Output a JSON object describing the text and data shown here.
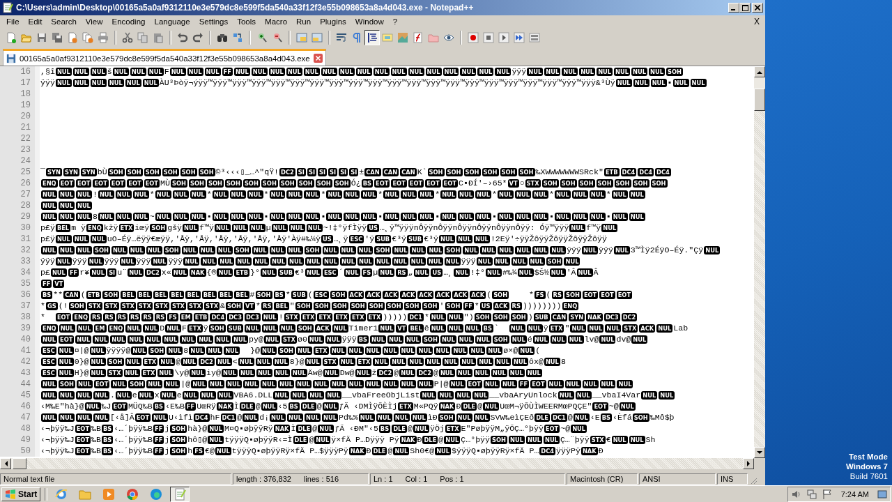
{
  "window": {
    "title": "C:\\Users\\admin\\Desktop\\00165a5a0af9312110e3e579dc8e599f5da540a33f12f3e55b098653a8a4d043.exe - Notepad++"
  },
  "menu": [
    "File",
    "Edit",
    "Search",
    "View",
    "Encoding",
    "Language",
    "Settings",
    "Tools",
    "Macro",
    "Run",
    "Plugins",
    "Window",
    "?"
  ],
  "menu_close": "X",
  "toolbar": [
    {
      "kind": "new",
      "pressed": false
    },
    {
      "kind": "open",
      "pressed": false
    },
    {
      "kind": "save",
      "pressed": false
    },
    {
      "kind": "saveall",
      "pressed": false
    },
    {
      "kind": "close",
      "pressed": false
    },
    {
      "kind": "closeall",
      "pressed": false
    },
    {
      "kind": "print",
      "pressed": false
    },
    {
      "kind": "sep"
    },
    {
      "kind": "cut",
      "pressed": false
    },
    {
      "kind": "copy",
      "pressed": false
    },
    {
      "kind": "paste",
      "pressed": false
    },
    {
      "kind": "sep"
    },
    {
      "kind": "undo",
      "pressed": false
    },
    {
      "kind": "redo",
      "pressed": false
    },
    {
      "kind": "sep"
    },
    {
      "kind": "find",
      "pressed": false
    },
    {
      "kind": "replace",
      "pressed": false
    },
    {
      "kind": "sep"
    },
    {
      "kind": "zoomin",
      "pressed": false
    },
    {
      "kind": "zoomout",
      "pressed": false
    },
    {
      "kind": "sep"
    },
    {
      "kind": "syncv",
      "pressed": false
    },
    {
      "kind": "synch",
      "pressed": false
    },
    {
      "kind": "sep"
    },
    {
      "kind": "wrap",
      "pressed": false
    },
    {
      "kind": "pilcrow",
      "pressed": false
    },
    {
      "kind": "indent",
      "pressed": true
    },
    {
      "kind": "lang",
      "pressed": false
    },
    {
      "kind": "map",
      "pressed": false
    },
    {
      "kind": "func",
      "pressed": false
    },
    {
      "kind": "folder",
      "pressed": false
    },
    {
      "kind": "eye",
      "pressed": false
    },
    {
      "kind": "sep"
    },
    {
      "kind": "record",
      "pressed": false
    },
    {
      "kind": "stop",
      "pressed": false
    },
    {
      "kind": "play",
      "pressed": false
    },
    {
      "kind": "playmulti",
      "pressed": false
    },
    {
      "kind": "savemacro",
      "pressed": false
    }
  ],
  "tabs": [
    {
      "label": "00165a5a0af9312110e3e579dc8e599f5da540a33f12f3e55b098653a8a4d043.exe",
      "selected": true
    }
  ],
  "editor": {
    "lines": [
      {
        "number": "16",
        "parts": [
          ",§î",
          [
            "NUL",
            "NUL",
            "NUL"
          ],
          "š",
          [
            "NUL",
            "NUL",
            "NUL"
          ],
          "F",
          [
            "NUL",
            "NUL",
            "NUL",
            "FF",
            "NUL",
            "NUL",
            "NUL",
            "NUL",
            "NUL",
            "NUL",
            "NUL",
            "NUL",
            "NUL",
            "NUL",
            "NUL",
            "NUL",
            "NUL",
            "NUL",
            "NUL",
            "NUL"
          ],
          "ÿÿÿ",
          [
            "NUL",
            "NUL",
            "NUL",
            "NUL",
            "NUL",
            "NUL",
            "NUL",
            "NUL",
            "SOH"
          ]
        ]
      },
      {
        "number": "17",
        "parts": [
          "ÿÿÿ",
          [
            "NUL",
            "NUL",
            "NUL",
            "NUL",
            "NUL",
            "NUL"
          ],
          "ÀU³Þòÿ¬ýÿÿ™ÿÿÿ™ÿÿÿ™ÿÿÿ™ÿÿÿ™ÿÿÿ™ÿÿÿ™ÿÿÿ™ÿÿÿ™ÿÿÿ™ÿÿÿ™ÿÿÿ™ÿÿÿ™ÿÿÿ™ÿÿÿ™ÿÿÿ™ÿÿÿ™ÿÿÿ™ÿÿÿ™ÿÿÿ™ÿÿÿ&³Ùÿ",
          [
            "NUL",
            "NUL",
            "NUL"
          ],
          "▪",
          [
            "NUL",
            "NUL"
          ]
        ]
      },
      {
        "number": "18"
      },
      {
        "number": "19"
      },
      {
        "number": "20"
      },
      {
        "number": "21"
      },
      {
        "number": "22"
      },
      {
        "number": "23"
      },
      {
        "number": "24"
      },
      {
        "number": "25",
        "parts": [
          "¯",
          [
            "SYN",
            "SYN",
            "SYN"
          ],
          "bÙ",
          [
            "SOH",
            "SOH",
            "SOH",
            "SOH",
            "SOH",
            "SOH"
          ],
          "©³‹‹‹▯_…^″qŸ!",
          [
            "DC2",
            "SI",
            "SI",
            "SI",
            "SI",
            "SI",
            "SI"
          ],
          "±",
          [
            "CAN",
            "CAN",
            "CAN"
          ],
          "K`",
          [
            "SOH",
            "SOH",
            "SOH",
            "SOH",
            "SOH",
            "SOH"
          ],
          "‰XWWWWWWWSRck\"",
          [
            "ETB",
            "DC4",
            "DC4",
            "DC4"
          ]
        ]
      },
      {
        "number": "26",
        "parts": [
          [
            "ENQ",
            "EOT",
            "EOT",
            "EOT",
            "EOT",
            "EOT",
            "EOT"
          ],
          "MÙ",
          [
            "SOH",
            "SOH",
            "SOH",
            "SOH",
            "SOH",
            "SOH",
            "SOH",
            "SOH",
            "SOH",
            "SOH"
          ],
          "Ó¿",
          [
            "BS",
            "EOT",
            "EOT",
            "EOT",
            "EOT",
            "EOT"
          ],
          "C▪ÐÍ'–›65*",
          [
            "VT"
          ],
          "○",
          [
            "STX",
            "SOH",
            "SOH",
            "SOH",
            "SOH",
            "SOH",
            "SOH",
            "SOH"
          ]
        ]
      },
      {
        "number": "27",
        "parts": [
          [
            "NUL",
            "NUL",
            "NUL"
          ],
          "!",
          [
            "NUL",
            "NUL",
            "NUL"
          ],
          "*",
          [
            "NUL",
            "NUL",
            "NUL"
          ],
          "*",
          [
            "NUL",
            "NUL",
            "NUL"
          ],
          "*",
          [
            "NUL",
            "NUL",
            "NUL"
          ],
          "*",
          [
            "NUL",
            "NUL",
            "NUL"
          ],
          "*",
          [
            "NUL",
            "NUL",
            "NUL"
          ],
          "*",
          [
            "NUL",
            "NUL",
            "NUL"
          ],
          "*",
          [
            "NUL",
            "NUL",
            "NUL"
          ],
          "*",
          [
            "NUL",
            "NUL",
            "NUL"
          ],
          "*",
          [
            "NUL",
            "NUL"
          ]
        ]
      },
      {
        "number": "28",
        "parts": [
          [
            "NUL",
            "NUL",
            "NUL"
          ]
        ]
      },
      {
        "number": "29",
        "parts": [
          [
            "NUL",
            "NUL",
            "NUL"
          ],
          "8",
          [
            "NUL",
            "NUL",
            "NUL"
          ],
          "~",
          [
            "NUL",
            "NUL",
            "NUL"
          ],
          "▪",
          [
            "NUL",
            "NUL",
            "NUL"
          ],
          "▪",
          [
            "NUL",
            "NUL",
            "NUL"
          ],
          "▪",
          [
            "NUL",
            "NUL",
            "NUL"
          ],
          "▪",
          [
            "NUL",
            "NUL",
            "NUL"
          ],
          "▪",
          [
            "NUL",
            "NUL",
            "NUL"
          ],
          "▪",
          [
            "NUL",
            "NUL",
            "NUL"
          ],
          "▪",
          [
            "NUL",
            "NUL",
            "NUL"
          ],
          "▪",
          [
            "NUL",
            "NUL"
          ]
        ]
      },
      {
        "number": "30",
        "parts": [
          "p£ÿ",
          [
            "BEL"
          ],
          "m ÿ",
          [
            "ENQ"
          ],
          "kžÿ",
          [
            "ETX"
          ],
          "iœÿ",
          [
            "SOH"
          ],
          "gšÿ",
          [
            "NUL"
          ],
          "f™ÿ",
          [
            "NUL",
            "NUL",
            "NUL"
          ],
          "µ",
          [
            "NUL",
            "NUL",
            "NUL"
          ],
          "~!‡°ÿfÌÿÿ",
          [
            "US"
          ],
          "…¸ÿ™ÿÿÿnÔÿÿnÔÿÿnÔÿÿnÔÿÿnÔÿÿnÔÿÿ: Óÿ™ÿÿÿ",
          [
            "NUL"
          ],
          "f™ÿ",
          [
            "NUL"
          ]
        ]
      },
      {
        "number": "31",
        "parts": [
          "p£ÿ",
          [
            "NUL",
            "NUL",
            "NUL"
          ],
          "uO–Éÿ…ëÿÿ€æÿÿ,'Åÿ,'Åÿ,'Åÿ,'Åÿ,'Åÿ,'Åÿ'Àÿ#‰¼ÿ",
          [
            "US"
          ],
          "…¸ÿ",
          [
            "ESC"
          ],
          "'ÿ",
          [
            "SUB"
          ],
          "€³ÿ",
          [
            "SUB"
          ],
          "€³ÿ",
          [
            "NUL",
            "NUL",
            "NUL"
          ],
          "!2Eÿ'÷ÿÿŽôÿÿŽôÿÿŽôÿÿŽôÿÿ"
        ]
      },
      {
        "number": "32",
        "parts": [
          [
            "NUL",
            "NUL",
            "NUL",
            "SOH",
            "NUL",
            "NUL",
            "NUL",
            "SOH",
            "NUL",
            "NUL",
            "NUL",
            "SOH",
            "NUL",
            "NUL",
            "NUL",
            "SOH",
            "NUL",
            "NUL",
            "NUL",
            "SOH",
            "NUL",
            "NUL",
            "NUL",
            "SOH",
            "NUL",
            "NUL",
            "NUL",
            "NUL",
            "NUL",
            "NUL"
          ],
          "ÿÿÿ",
          [
            "NUL"
          ],
          "ÿÿÿ",
          [
            "NUL"
          ],
          "3™Ìÿ2ÉÿO–Éÿ.″Çÿ",
          [
            "NUL"
          ]
        ]
      },
      {
        "number": "33",
        "parts": [
          "ÿÿÿ",
          [
            "NUL"
          ],
          "ÿÿÿ",
          [
            "NUL"
          ],
          "ÿÿÿ",
          [
            "NUL"
          ],
          "ÿÿÿ",
          [
            "NUL"
          ],
          "ÿÿÿ",
          [
            "NUL",
            "NUL",
            "NUL",
            "NUL",
            "NUL",
            "NUL",
            "NUL",
            "NUL",
            "NUL",
            "NUL",
            "NUL",
            "NUL",
            "NUL",
            "NUL",
            "NUL",
            "NUL"
          ],
          "ÿÿÿ",
          [
            "NUL",
            "NUL",
            "NUL",
            "NUL",
            "SOH",
            "NUL"
          ]
        ]
      },
      {
        "number": "34",
        "parts": [
          "p£",
          [
            "NUL",
            "FF"
          ],
          "r¥",
          [
            "NUL",
            "SI"
          ],
          "u¨",
          [
            "NUL",
            "DC2"
          ],
          "x«",
          [
            "NUL",
            "NAK"
          ],
          "{®",
          [
            "NUL",
            "ETB"
          ],
          "}°",
          [
            "NUL",
            "SUB"
          ],
          "€³",
          [
            "NUL",
            "ESC"
          ],
          "´",
          [
            "NUL",
            "FS"
          ],
          "µ",
          [
            "NUL",
            "RS"
          ],
          "„",
          [
            "NUL",
            "US"
          ],
          "…¸",
          [
            "NUL"
          ],
          "!‡°",
          [
            "NUL"
          ],
          "#‰¼",
          [
            "NUL"
          ],
          "$Š½",
          [
            "NUL"
          ],
          "'Â",
          [
            "NUL"
          ],
          "Â"
        ]
      },
      {
        "number": "35",
        "parts": [
          [
            "FF",
            "VT"
          ]
        ]
      },
      {
        "number": "36",
        "parts": [
          [
            "BS"
          ],
          "**",
          [
            "CAN"
          ],
          "(",
          [
            "ETB",
            "SOH",
            "BEL",
            "BEL",
            "BEL",
            "BEL",
            "BEL",
            "BEL",
            "BEL",
            "BEL"
          ],
          "#",
          [
            "SOH",
            "BS"
          ],
          "*",
          [
            "SUB"
          ],
          "(",
          [
            "ESC",
            "SOH",
            "ACK",
            "ACK",
            "ACK",
            "ACK",
            "ACK",
            "ACK",
            "ACK",
            "ACK"
          ],
          "(",
          [
            "SOH"
          ],
          "    *",
          [
            "FS"
          ],
          "(",
          [
            "RS",
            "SOH",
            "EOT",
            "EOT",
            "EOT"
          ]
        ]
      },
      {
        "number": "37",
        "parts": [
          "*",
          [
            "GS"
          ],
          "(!",
          [
            "SOH",
            "STX",
            "STX",
            "STX",
            "STX",
            "STX",
            "STX",
            "STX",
            "STX"
          ],
          "&",
          [
            "SOH",
            "VT"
          ],
          "*",
          [
            "RS",
            "BEL"
          ],
          "\"",
          [
            "SOH",
            "SOH",
            "SOH",
            "SOH",
            "SOH",
            "SOH",
            "SOH",
            "SOH"
          ],
          "'",
          [
            "SOH",
            "FF"
          ],
          "*",
          [
            "US",
            "ACK",
            "RS"
          ],
          "))))))))",
          [
            "ENQ"
          ]
        ]
      },
      {
        "number": "38",
        "parts": [
          "*  ",
          [
            "EOT",
            "ENQ",
            "RS",
            "RS",
            "RS",
            "RS",
            "RS",
            "RS",
            "FS",
            "EM",
            "ETB",
            "DC4",
            "DC3",
            "DC3",
            "NUL"
          ],
          "!",
          [
            "STX",
            "ETX",
            "ETX",
            "ETX",
            "ETX",
            "ETX"
          ],
          ")))))",
          [
            "DC1"
          ],
          "*",
          [
            "NUL",
            "NUL"
          ],
          "\")",
          [
            "SOH",
            "SOH",
            "SOH"
          ],
          ")",
          [
            "SUB",
            "CAN",
            "SYN",
            "NAK",
            "DC3",
            "DC2"
          ]
        ]
      },
      {
        "number": "39",
        "parts": [
          [
            "ENQ",
            "NUL",
            "NUL",
            "EM",
            "ENQ",
            "NUL",
            "NUL"
          ],
          "D",
          [
            "NUL"
          ],
          "F",
          [
            "ETX"
          ],
          "ÿ",
          [
            "SOH",
            "SUB",
            "NUL",
            "NUL",
            "NUL",
            "SOH",
            "ACK",
            "NUL"
          ],
          "Timer1",
          [
            "NUL",
            "VT",
            "BEL"
          ],
          "ê",
          [
            "NUL",
            "NUL",
            "NUL",
            "BS"
          ],
          "`  ",
          [
            "NUL",
            "NUL"
          ],
          "ÿ",
          [
            "ETX"
          ],
          "\"",
          [
            "NUL",
            "NUL",
            "NUL",
            "STX",
            "ACK",
            "NUL"
          ],
          "Lab"
        ]
      },
      {
        "number": "40",
        "parts": [
          [
            "NUL",
            "EOT",
            "NUL",
            "NUL",
            "NUL",
            "NUL",
            "NUL",
            "NUL",
            "NUL",
            "NUL",
            "NUL",
            "NUL"
          ],
          "py@",
          [
            "NUL",
            "STX"
          ],
          "ø0",
          [
            "NUL",
            "NUL"
          ],
          "ÿÿÿ",
          [
            "BS",
            "NUL",
            "NUL",
            "NUL",
            "SOH",
            "NUL",
            "NUL",
            "NUL",
            "SOH",
            "NUL"
          ],
          "é",
          [
            "NUL",
            "NUL",
            "NUL"
          ],
          "lv@",
          [
            "NUL"
          ],
          "dv@",
          [
            "NUL"
          ]
        ]
      },
      {
        "number": "41",
        "parts": [
          [
            "ESC",
            "NUL"
          ],
          "¤|@",
          [
            "NUL"
          ],
          "ÿÿÿÿ@",
          [
            "NUL",
            "SOH",
            "NUL"
          ],
          "8",
          [
            "NUL",
            "NUL",
            "NUL"
          ],
          "  }@",
          [
            "NUL",
            "SOH",
            "NUL",
            "ETX",
            "NUL",
            "NUL",
            "NUL",
            "NUL",
            "NUL",
            "NUL",
            "NUL",
            "NUL",
            "NUL",
            "NUL"
          ],
          "ø×@",
          [
            "NUL"
          ],
          "("
        ]
      },
      {
        "number": "42",
        "parts": [
          [
            "ESC",
            "NUL"
          ],
          "0}@",
          [
            "NUL",
            "SOH",
            "NUL",
            "ETX",
            "NUL"
          ],
          "@",
          [
            "NUL",
            "DC2",
            "NUL"
          ],
          "<",
          [
            "NUL",
            "NUL",
            "NUL"
          ],
          "8}@",
          [
            "NUL",
            "STX",
            "NUL",
            "ETX",
            "NUL",
            "NUL",
            "NUL",
            "NUL",
            "NUL",
            "NUL",
            "NUL",
            "NUL",
            "NUL"
          ],
          "ôx@",
          [
            "NUL"
          ],
          "8"
        ]
      },
      {
        "number": "43",
        "parts": [
          [
            "ESC",
            "NUL"
          ],
          "H}@",
          [
            "NUL",
            "STX",
            "NUL",
            "ETX",
            "NUL"
          ],
          "\\y@",
          [
            "NUL"
          ],
          "iy@",
          [
            "NUL",
            "NUL",
            "NUL",
            "NUL",
            "NUL"
          ],
          "Äw@",
          [
            "NUL"
          ],
          "Dw@",
          [
            "NUL"
          ],
          "ž",
          [
            "DC2"
          ],
          "@",
          [
            "NUL",
            "DC2"
          ],
          "@",
          [
            "NUL",
            "NUL",
            "NUL",
            "NUL",
            "NUL",
            "NUL"
          ]
        ]
      },
      {
        "number": "44",
        "parts": [
          [
            "NUL",
            "SOH",
            "NUL",
            "EOT",
            "NUL",
            "SOH",
            "NUL",
            "NUL"
          ],
          "|@",
          [
            "NUL",
            "NUL",
            "NUL",
            "NUL",
            "NUL",
            "NUL",
            "NUL",
            "NUL",
            "NUL",
            "NUL",
            "NUL",
            "NUL",
            "NUL",
            "NUL"
          ],
          "P|@",
          [
            "NUL",
            "EOT",
            "NUL",
            "NUL",
            "FF",
            "EOT",
            "NUL",
            "NUL",
            "NUL",
            "NUL",
            "NUL"
          ]
        ]
      },
      {
        "number": "45",
        "parts": [
          [
            "NUL",
            "NUL",
            "NUL",
            "NUL"
          ],
          ".",
          [
            "NUL"
          ],
          "e",
          [
            "NUL"
          ],
          "x",
          [
            "NUL"
          ],
          "e",
          [
            "NUL",
            "NUL",
            "NUL"
          ],
          "VBA6.DLL",
          [
            "NUL",
            "NUL",
            "NUL",
            "NUL"
          ],
          "__vbaFreeObjList",
          [
            "NUL",
            "NUL",
            "NUL",
            "NUL"
          ],
          "__vbaAryUnlock",
          [
            "NUL",
            "NUL"
          ],
          "__vbaI4Var",
          [
            "NUL",
            "NUL"
          ]
        ]
      },
      {
        "number": "46",
        "parts": [
          "‹M‰E″hà}@",
          [
            "NUL"
          ],
          "‰J",
          [
            "EOT"
          ],
          "MÜQ‰B",
          [
            "BS"
          ],
          "‹E‰B",
          [
            "FF"
          ],
          "UœRÿ",
          [
            "NAK"
          ],
          "Ì",
          [
            "DLE"
          ],
          "@",
          [
            "NUL"
          ],
          "‹5",
          [
            "BS",
            "DLE"
          ],
          "@",
          [
            "NUL"
          ],
          "ƒÄ ‹DMÌÿÕÈÌj",
          [
            "ETX"
          ],
          "M«PQÿ",
          [
            "NAK"
          ],
          "Ð",
          [
            "DLE"
          ],
          "@",
          [
            "NUL"
          ],
          "UœM¬ÿÕÙÌWEERMœPQÇE″",
          [
            "EOT"
          ],
          "~@",
          [
            "NUL"
          ]
        ]
      },
      {
        "number": "47",
        "parts": [
          [
            "NUL",
            "NUL",
            "NUL",
            "NUL"
          ],
          "[‹å]Â",
          [
            "EOT",
            "NUL"
          ],
          "U‹ìfì",
          [
            "DC4"
          ],
          "hF",
          [
            "DC1"
          ],
          "@",
          [
            "NUL"
          ],
          "d¡",
          [
            "NUL",
            "NUL",
            "NUL",
            "NUL"
          ],
          "Pd‰%",
          [
            "NUL",
            "NUL",
            "NUL",
            "NUL"
          ],
          "ìÐ",
          [
            "SOH",
            "NUL",
            "NUL"
          ],
          "SVW‰eìÇEð",
          [
            "DLE",
            "DC1"
          ],
          "@",
          [
            "NUL"
          ],
          "‹E",
          [
            "BS"
          ],
          "‹Èfá",
          [
            "SOH"
          ],
          "‰Mô$þ"
        ]
      },
      {
        "number": "48",
        "parts": [
          "‹¬þÿÿ‰J",
          [
            "EOT"
          ],
          "‰B",
          [
            "BS"
          ],
          "‹…´þÿÿ‰B",
          [
            "FF"
          ],
          "j",
          [
            "SOH"
          ],
          "hà}@",
          [
            "NUL"
          ],
          "M¤Q▪øþÿÿRÿ",
          [
            "NAK"
          ],
          "Ì",
          [
            "DLE"
          ],
          "@",
          [
            "NUL"
          ],
          "ƒÄ ‹ÐM″‹5",
          [
            "BS",
            "DLE"
          ],
          "@",
          [
            "NUL"
          ],
          "ÿÖj",
          [
            "ETX"
          ],
          "E″PøþÿÿM„ÿÖÇ…°þÿÿ",
          [
            "EOT"
          ],
          "~@",
          [
            "NUL"
          ]
        ]
      },
      {
        "number": "49",
        "parts": [
          "‹¬þÿÿ‰J",
          [
            "EOT"
          ],
          "‰B",
          [
            "BS"
          ],
          "‹…´þÿÿ‰B",
          [
            "FF"
          ],
          "j",
          [
            "SOH"
          ],
          "hô▯@",
          [
            "NUL"
          ],
          "tÿÿÿQ▪øþÿÿR‹=Ì",
          [
            "DLE"
          ],
          "@",
          [
            "NUL"
          ],
          "ÿ×fÄ P…Dÿÿÿ Pÿ",
          [
            "NAK"
          ],
          "Ð",
          [
            "DLE"
          ],
          "@",
          [
            "NUL"
          ],
          "Ç…°þÿÿ",
          [
            "SOH",
            "NUL",
            "NUL",
            "NUL"
          ],
          "Ç…¨þÿÿ",
          [
            "STX"
          ],
          "€",
          [
            "NUL",
            "NUL"
          ],
          "Sh"
        ]
      },
      {
        "number": "50",
        "parts": [
          "‹¬þÿÿ‰J",
          [
            "EOT"
          ],
          "‰B",
          [
            "BS"
          ],
          "‹…´þÿÿ‰B",
          [
            "FF"
          ],
          "j",
          [
            "SOH"
          ],
          "h",
          [
            "FS"
          ],
          "€@",
          [
            "NUL"
          ],
          "tÿÿÿQ▪øþÿÿRÿ×fÄ P…$ÿÿÿPÿ",
          [
            "NAK"
          ],
          "Ð",
          [
            "DLE"
          ],
          "@",
          [
            "NUL"
          ],
          "Sh0€@",
          [
            "NUL"
          ],
          "$ÿÿÿQ▪øþÿÿRÿ×fÄ P…",
          [
            "DC4"
          ],
          "ÿÿÿPÿ",
          [
            "NAK"
          ],
          "Ð"
        ]
      }
    ]
  },
  "status_bar": [
    [
      "Normal text file"
    ],
    [
      "length : 376,832",
      "lines : 516"
    ],
    [
      "Ln : 1",
      "Col : 1",
      "Pos : 1"
    ],
    [
      "Macintosh (CR)"
    ],
    [
      "ANSI"
    ],
    [
      "INS"
    ]
  ],
  "desktop": {
    "watermark_lines": [
      "Test Mode",
      "Windows 7",
      "Build 7601"
    ]
  },
  "taskbar": {
    "start": "Start",
    "apps": [
      {
        "kind": "ie",
        "selected": false
      },
      {
        "kind": "folder",
        "selected": false
      },
      {
        "kind": "media",
        "selected": false
      },
      {
        "kind": "chrome",
        "selected": false
      },
      {
        "kind": "edge",
        "selected": false
      },
      {
        "kind": "notepad",
        "selected": true
      }
    ],
    "clock": "7:24 AM"
  }
}
